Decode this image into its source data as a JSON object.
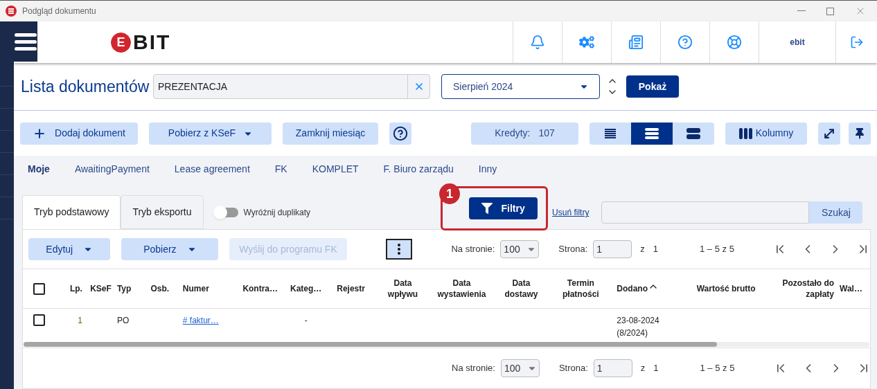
{
  "window": {
    "title": "Podgląd dokumentu"
  },
  "header": {
    "logo": {
      "badge": "E",
      "text": "BIT"
    },
    "user": "ebit"
  },
  "page": {
    "title": "Lista dokumentów",
    "search_value": "PREZENTACJA",
    "month": "Sierpień 2024",
    "show_button": "Pokaż"
  },
  "toolbar": {
    "add_button": "Dodaj dokument",
    "ksef_button": "Pobierz z KSeF",
    "close_month_button": "Zamknij miesiąc",
    "credits_label": "Kredyty:",
    "credits_value": "107",
    "density": [
      {
        "kind": "compact",
        "selected": false
      },
      {
        "kind": "normal",
        "selected": true
      },
      {
        "kind": "large",
        "selected": false
      }
    ],
    "columns_button": "Kolumny"
  },
  "categories": [
    {
      "label": "Moje",
      "selected": true
    },
    {
      "label": "AwaitingPayment",
      "selected": false
    },
    {
      "label": "Lease agreement",
      "selected": false
    },
    {
      "label": "FK",
      "selected": false
    },
    {
      "label": "KOMPLET",
      "selected": false
    },
    {
      "label": "F. Biuro zarządu",
      "selected": false
    },
    {
      "label": "Inny",
      "selected": false
    }
  ],
  "modes": [
    {
      "label": "Tryb podstawowy",
      "selected": true
    },
    {
      "label": "Tryb eksportu",
      "selected": false
    }
  ],
  "duplicates_toggle": {
    "label": "Wyróżnij duplikaty",
    "on": false
  },
  "filters": {
    "button": "Filtry",
    "annotation": "1",
    "remove_link": "Usuń filtry",
    "search_button": "Szukaj"
  },
  "actions": [
    {
      "label": "Edytuj",
      "dropdown": true,
      "disabled": false
    },
    {
      "label": "Pobierz",
      "dropdown": true,
      "disabled": false
    },
    {
      "label": "Wyślij do programu FK",
      "dropdown": false,
      "disabled": true
    }
  ],
  "pagination_top": {
    "per_page_label": "Na stronie:",
    "per_page": "100",
    "page_label": "Strona:",
    "page": "1",
    "of_label": "z",
    "pages": "1",
    "range": "1 – 5 z 5"
  },
  "table": {
    "select_all_checked": false,
    "columns": [
      {
        "label": "Lp.",
        "sorted": false
      },
      {
        "label": "KSeF",
        "sorted": false
      },
      {
        "label": "Typ",
        "sorted": false
      },
      {
        "label": "Osb.",
        "sorted": false
      },
      {
        "label": "Numer",
        "sorted": false
      },
      {
        "label": "Kontra…",
        "sorted": false
      },
      {
        "label": "Kateg…",
        "sorted": false
      },
      {
        "label": "Rejestr",
        "sorted": false
      },
      {
        "label": "Data wpływu",
        "sorted": false
      },
      {
        "label": "Data wystawienia",
        "sorted": false
      },
      {
        "label": "Data dostawy",
        "sorted": false
      },
      {
        "label": "Termin płatności",
        "sorted": false
      },
      {
        "label": "Dodano",
        "sorted": true
      },
      {
        "label": "Wartość brutto",
        "sorted": false
      },
      {
        "label": "Pozostało do zapłaty",
        "sorted": false
      },
      {
        "label": "Wal…",
        "sorted": false
      }
    ],
    "rows": [
      {
        "checked": false,
        "lp": "1",
        "typ": "PO",
        "numer": "# faktur…",
        "kategoria": "-",
        "dodano": "23-08-2024",
        "dodano_period": "(8/2024)"
      }
    ]
  },
  "pagination_bottom": {
    "per_page_label": "Na stronie:",
    "per_page": "100",
    "page_label": "Strona:",
    "page": "1",
    "of_label": "z",
    "pages": "1",
    "range": "1 – 5 z 5"
  }
}
